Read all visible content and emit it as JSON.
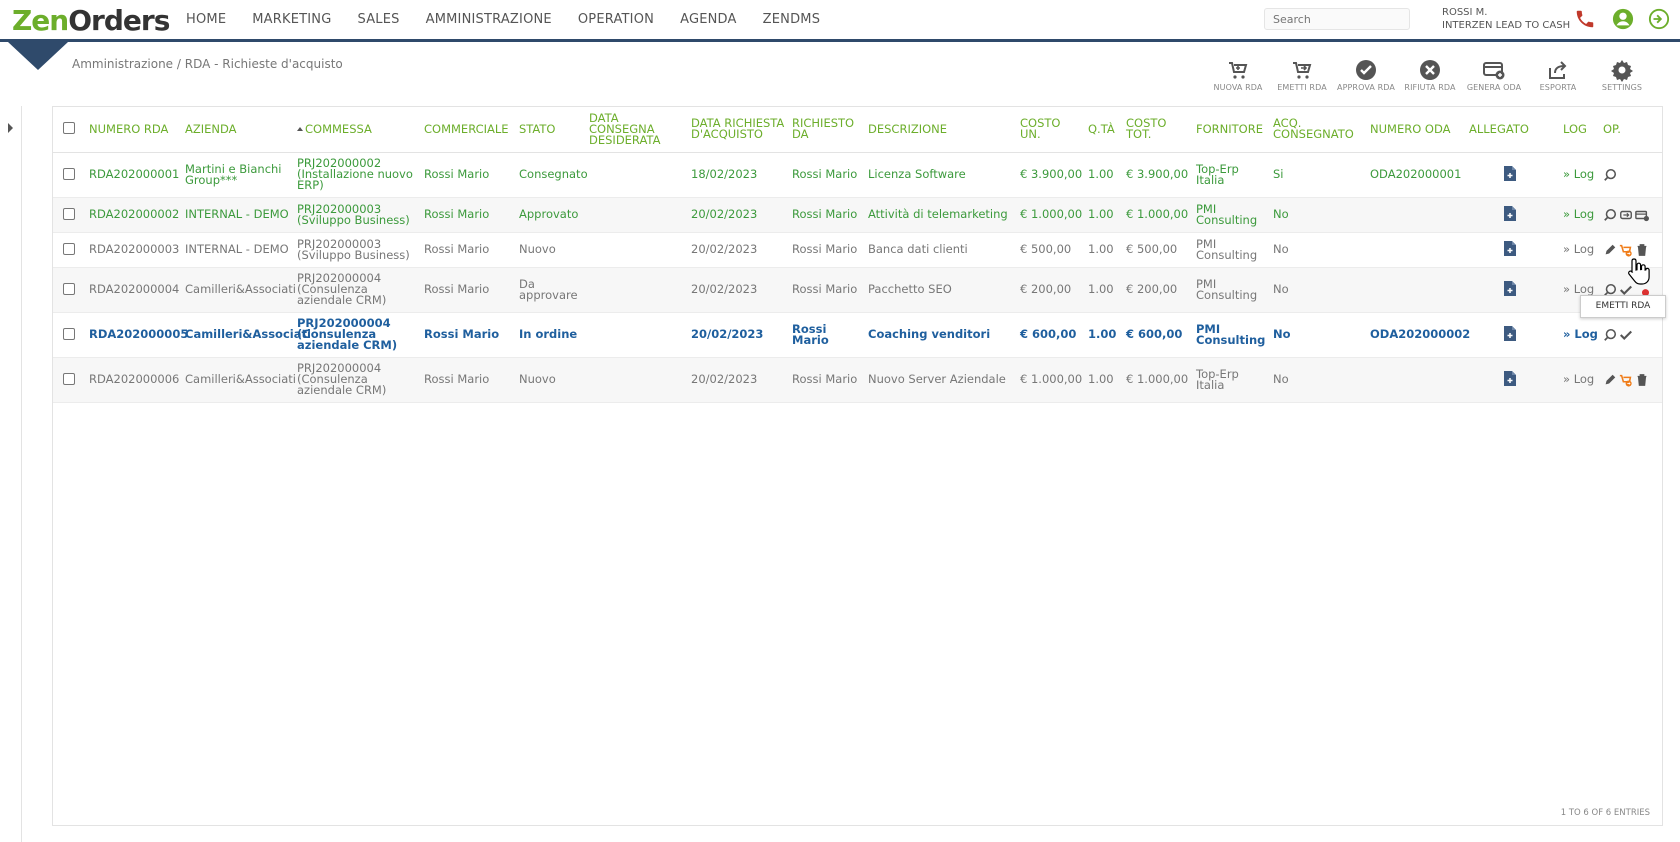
{
  "app": {
    "logo_zen": "Zen",
    "logo_orders": "Orders"
  },
  "nav": [
    "HOME",
    "MARKETING",
    "SALES",
    "AMMINISTRAZIONE",
    "OPERATION",
    "AGENDA",
    "ZENDMS"
  ],
  "search": {
    "placeholder": "Search"
  },
  "user": {
    "name": "ROSSI M.",
    "company": "INTERZEN LEAD TO CASH"
  },
  "breadcrumb": "Amministrazione / RDA - Richieste d'acquisto",
  "toolbar": [
    {
      "label": "NUOVA RDA",
      "icon": "add-cart-icon"
    },
    {
      "label": "EMETTI RDA",
      "icon": "send-cart-icon"
    },
    {
      "label": "APPROVA RDA",
      "icon": "check-circle-icon"
    },
    {
      "label": "RIFIUTA RDA",
      "icon": "x-circle-icon"
    },
    {
      "label": "GENERA ODA",
      "icon": "card-plus-icon"
    },
    {
      "label": "ESPORTA",
      "icon": "export-icon"
    },
    {
      "label": "SETTINGS",
      "icon": "gear-icon"
    }
  ],
  "columns": {
    "numero_rda": "NUMERO RDA",
    "azienda": "AZIENDA",
    "commessa": "COMMESSA",
    "commerciale": "COMMERCIALE",
    "stato": "STATO",
    "data_consegna": "DATA CONSEGNA DESIDERATA",
    "data_richiesta": "DATA RICHIESTA D'ACQUISTO",
    "richiesto_da": "RICHIESTO DA",
    "descrizione": "DESCRIZIONE",
    "costo_un": "COSTO UN.",
    "qta": "Q.TÀ",
    "costo_tot": "COSTO TOT.",
    "fornitore": "FORNITORE",
    "acq_consegnato": "ACQ. CONSEGNATO",
    "numero_oda": "NUMERO ODA",
    "allegato": "ALLEGATO",
    "log": "LOG",
    "op": "OP."
  },
  "rows": [
    {
      "numero_rda": "RDA202000001",
      "azienda": "Martini e Bianchi Group***",
      "commessa": "PRJ202000002 (Installazione nuovo ERP)",
      "commerciale": "Rossi Mario",
      "stato": "Consegnato",
      "data_consegna": "",
      "data_richiesta": "18/02/2023",
      "richiesto_da": "Rossi Mario",
      "descrizione": "Licenza Software",
      "costo_un": "€ 3.900,00",
      "qta": "1.00",
      "costo_tot": "€ 3.900,00",
      "fornitore": "Top-Erp Italia",
      "acq_consegnato": "Si",
      "numero_oda": "ODA202000001",
      "log": "» Log",
      "style": "green"
    },
    {
      "numero_rda": "RDA202000002",
      "azienda": "INTERNAL - DEMO",
      "commessa": "PRJ202000003 (Sviluppo Business)",
      "commerciale": "Rossi Mario",
      "stato": "Approvato",
      "data_consegna": "",
      "data_richiesta": "20/02/2023",
      "richiesto_da": "Rossi Mario",
      "descrizione": "Attività di telemarketing",
      "costo_un": "€ 1.000,00",
      "qta": "1.00",
      "costo_tot": "€ 1.000,00",
      "fornitore": "PMI Consulting",
      "acq_consegnato": "No",
      "numero_oda": "",
      "log": "» Log",
      "style": "green"
    },
    {
      "numero_rda": "RDA202000003",
      "azienda": "INTERNAL - DEMO",
      "commessa": "PRJ202000003 (Sviluppo Business)",
      "commerciale": "Rossi Mario",
      "stato": "Nuovo",
      "data_consegna": "",
      "data_richiesta": "20/02/2023",
      "richiesto_da": "Rossi Mario",
      "descrizione": "Banca dati clienti",
      "costo_un": "€ 500,00",
      "qta": "1.00",
      "costo_tot": "€ 500,00",
      "fornitore": "PMI Consulting",
      "acq_consegnato": "No",
      "numero_oda": "",
      "log": "» Log",
      "style": "grey"
    },
    {
      "numero_rda": "RDA202000004",
      "azienda": "Camilleri&Associati",
      "commessa": "PRJ202000004 (Consulenza aziendale CRM)",
      "commerciale": "Rossi Mario",
      "stato": "Da approvare",
      "data_consegna": "",
      "data_richiesta": "20/02/2023",
      "richiesto_da": "Rossi Mario",
      "descrizione": "Pacchetto SEO",
      "costo_un": "€ 200,00",
      "qta": "1.00",
      "costo_tot": "€ 200,00",
      "fornitore": "PMI Consulting",
      "acq_consegnato": "No",
      "numero_oda": "",
      "log": "» Log",
      "style": "grey"
    },
    {
      "numero_rda": "RDA202000005",
      "azienda": "Camilleri&Associati",
      "commessa": "PRJ202000004 (Consulenza aziendale CRM)",
      "commerciale": "Rossi Mario",
      "stato": "In ordine",
      "data_consegna": "",
      "data_richiesta": "20/02/2023",
      "richiesto_da": "Rossi Mario",
      "descrizione": "Coaching venditori",
      "costo_un": "€ 600,00",
      "qta": "1.00",
      "costo_tot": "€ 600,00",
      "fornitore": "PMI Consulting",
      "acq_consegnato": "No",
      "numero_oda": "ODA202000002",
      "log": "» Log",
      "style": "bold"
    },
    {
      "numero_rda": "RDA202000006",
      "azienda": "Camilleri&Associati",
      "commessa": "PRJ202000004 (Consulenza aziendale CRM)",
      "commerciale": "Rossi Mario",
      "stato": "Nuovo",
      "data_consegna": "",
      "data_richiesta": "20/02/2023",
      "richiesto_da": "Rossi Mario",
      "descrizione": "Nuovo Server Aziendale",
      "costo_un": "€ 1.000,00",
      "qta": "1.00",
      "costo_tot": "€ 1.000,00",
      "fornitore": "Top-Erp Italia",
      "acq_consegnato": "No",
      "numero_oda": "",
      "log": "» Log",
      "style": "grey"
    }
  ],
  "tooltip": "EMETTI RDA",
  "pagination": "1 TO 6 OF 6 ENTRIES",
  "colors": {
    "brand_green": "#6cae2b",
    "navy": "#2f4a6b",
    "phone_red": "#c0392b",
    "orange": "#f07d1a",
    "bold_blue": "#1f5f9e"
  }
}
